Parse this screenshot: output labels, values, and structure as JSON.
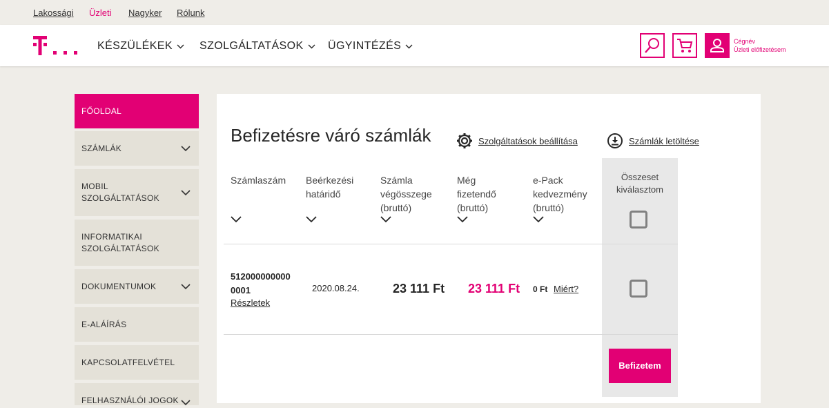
{
  "top_links": {
    "residential": "Lakossági",
    "business": "Üzleti",
    "wholesale": "Nagyker",
    "about": "Rólunk"
  },
  "nav": {
    "devices": "KÉSZÜLÉKEK",
    "services": "SZOLGÁLTATÁSOK",
    "administration": "ÜGYINTÉZÉS"
  },
  "user": {
    "company": "Cégnév",
    "account": "Üzleti előfizetésem"
  },
  "sidebar": {
    "items": [
      {
        "label": "FŐOLDAL"
      },
      {
        "label": "SZÁMLÁK"
      },
      {
        "label": "MOBIL SZOLGÁLTATÁSOK"
      },
      {
        "label": "INFORMATIKAI SZOLGÁLTATÁSOK"
      },
      {
        "label": "DOKUMENTUMOK"
      },
      {
        "label": "E-ALÁÍRÁS"
      },
      {
        "label": "KAPCSOLATFELVÉTEL"
      },
      {
        "label": "FELHASZNÁLÓI JOGOK"
      }
    ]
  },
  "main": {
    "title": "Befizetésre váró számlák",
    "settings_link": "Szolgáltatások beállítása",
    "download_link": "Számlák letöltése",
    "columns": [
      "Számlaszám",
      "Beérkezési határidő",
      "Számla végösszege (bruttó)",
      "Még fizetendő (bruttó)",
      "e-Pack kedvezmény (bruttó)"
    ],
    "select_all": "Összeset kiválasztom",
    "rows": [
      {
        "invoice_number": "5120000000000001",
        "details": "Részletek",
        "due_date": "2020.08.24.",
        "total": "23 111 Ft",
        "remaining": "23 111 Ft",
        "discount": "0 Ft",
        "why": "Miért?"
      }
    ],
    "pay_button": "Befizetem"
  },
  "colors": {
    "brand": "#e20074",
    "background": "#efede8",
    "sidebar_item": "#e4e1d8",
    "select_column": "#e8e8e8"
  }
}
